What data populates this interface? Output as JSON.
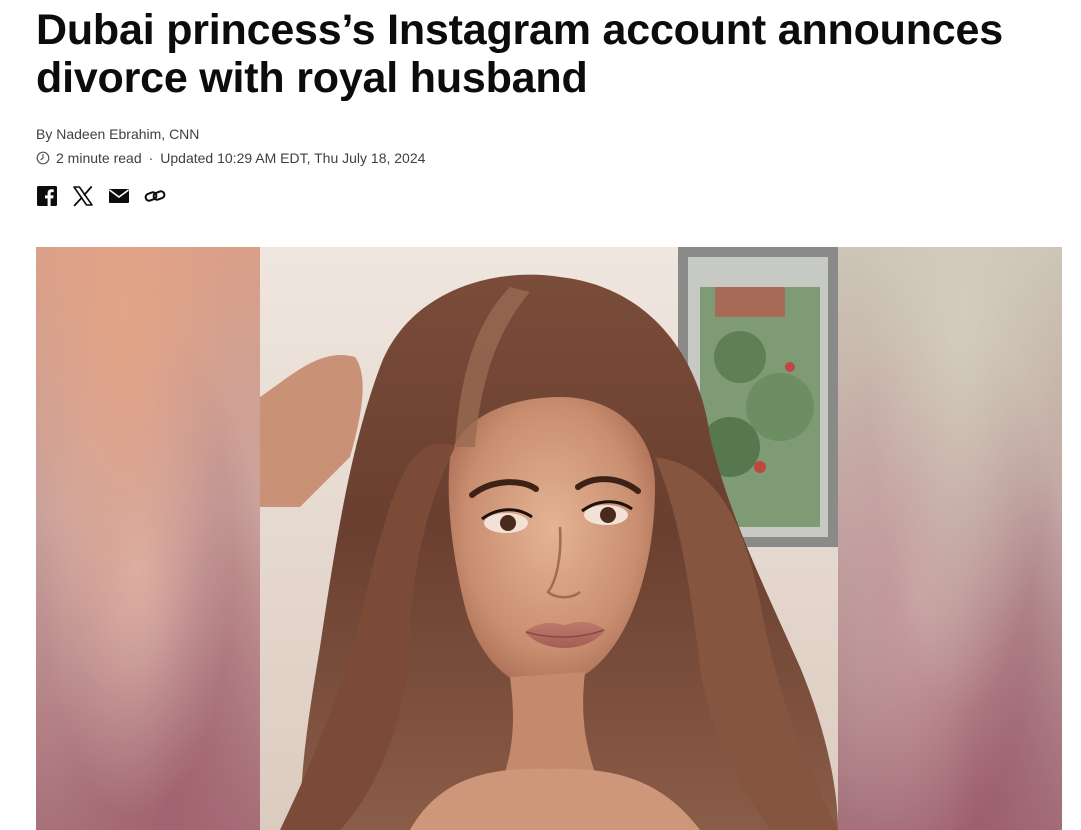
{
  "article": {
    "headline": "Dubai princess’s Instagram account announces divorce with royal husband",
    "byline": "By Nadeen Ebrahim, CNN",
    "read_time": "2 minute read",
    "separator": "·",
    "updated": "Updated 10:29 AM EDT, Thu July 18, 2024"
  },
  "share": {
    "icons": [
      "facebook-icon",
      "x-icon",
      "email-icon",
      "link-icon"
    ]
  },
  "colors": {
    "text": "#0c0c0c",
    "meta_text": "#404040",
    "background": "#ffffff"
  }
}
